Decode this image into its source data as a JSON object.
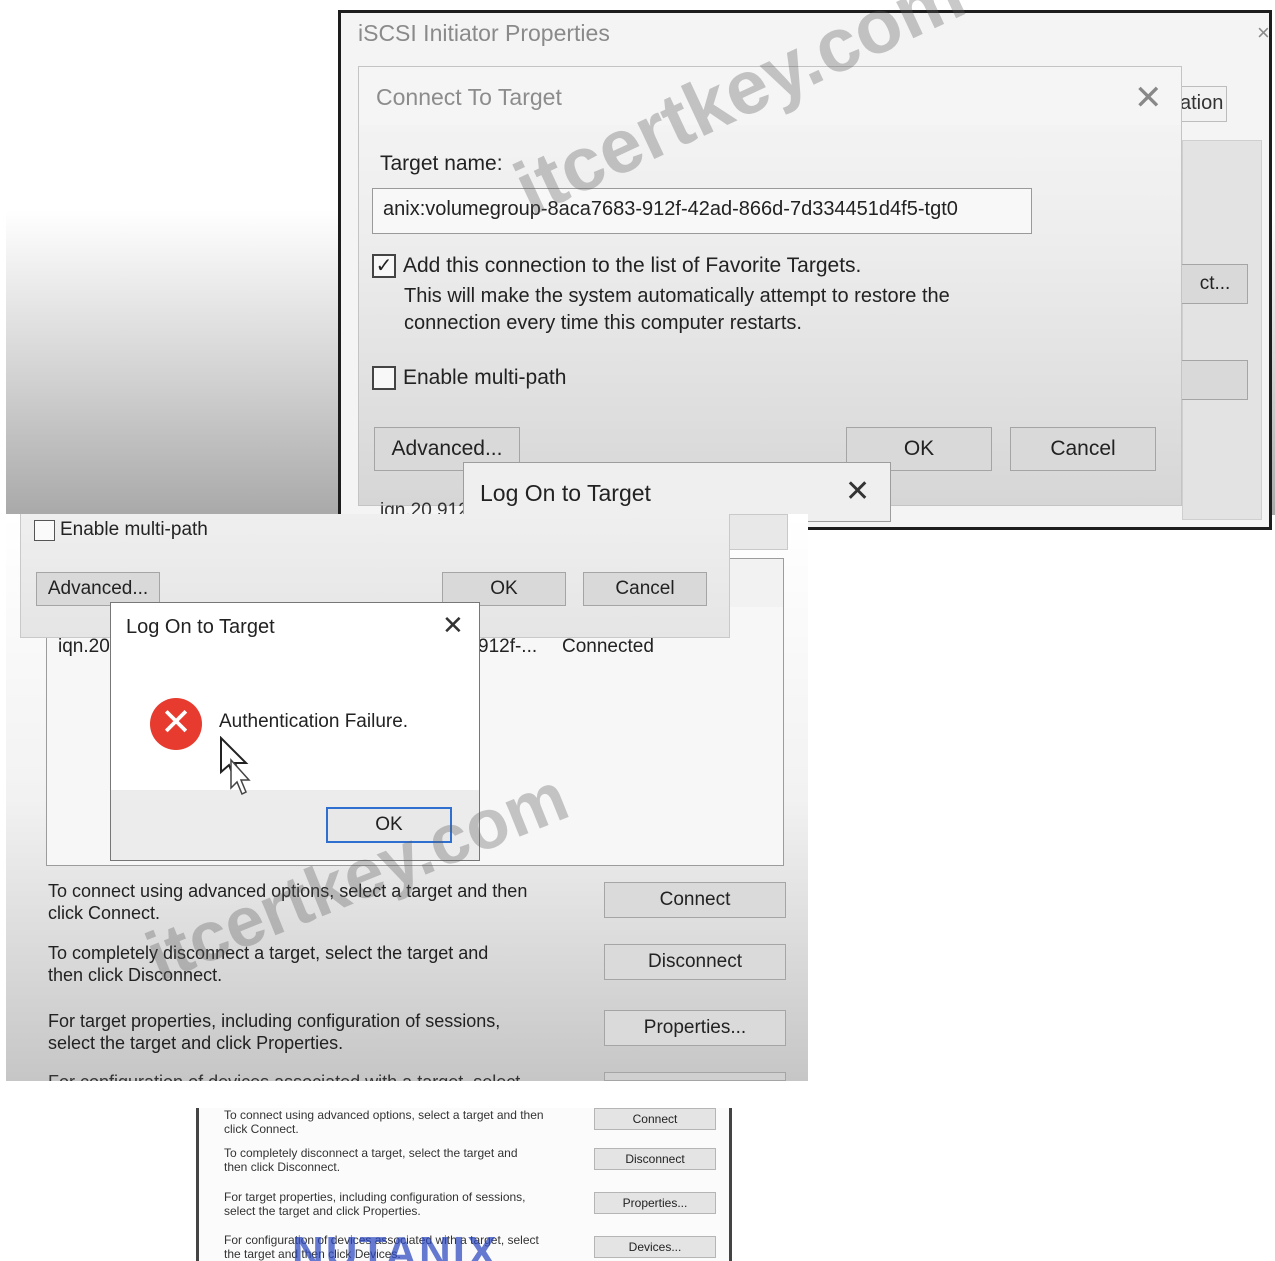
{
  "outer_window": {
    "title": "iSCSI Initiator Properties",
    "close_glyph": "×",
    "tab_fragment": "ation",
    "side_button_fragment": "ct..."
  },
  "connect_dialog": {
    "title": "Connect To Target",
    "close_glyph": "✕",
    "target_name_label": "Target name:",
    "target_name_value": "anix:volumegroup-8aca7683-912f-42ad-866d-7d334451d4f5-tgt0",
    "favorite_checkbox": {
      "checked": true,
      "glyph": "✓",
      "label": "Add this connection to the list of Favorite Targets.",
      "note_line1": "This will make the system automatically attempt to restore the",
      "note_line2": "connection every time this computer restarts."
    },
    "multipath_checkbox": {
      "checked": false,
      "label": "Enable multi-path"
    },
    "advanced_button": "Advanced...",
    "ok_button": "OK",
    "cancel_button": "Cancel"
  },
  "logon_dialog": {
    "title": "Log On to Target",
    "close_glyph": "✕",
    "error_glyph": "✕",
    "message": "Authentication Failure.",
    "ok_button": "OK"
  },
  "panel1_background": {
    "row_fragment": "iqn.20                                              912f        Connected"
  },
  "targets_list": {
    "row": {
      "iqn_fragment": "iqn.20",
      "name_fragment": "912f-...",
      "status": "Connected"
    }
  },
  "actions": [
    {
      "line1": "To connect using advanced options, select a target and then",
      "line2": "click Connect.",
      "button": "Connect"
    },
    {
      "line1": "To completely disconnect a target, select the target and",
      "line2": "then click Disconnect.",
      "button": "Disconnect"
    },
    {
      "line1": "For target properties, including configuration of sessions,",
      "line2": "select the target and click Properties.",
      "button": "Properties..."
    },
    {
      "line1": "For configuration of devices associated with a target, select",
      "line2": "the target and then click Devices.",
      "button": "Devices..."
    }
  ],
  "watermark": {
    "text1": "itcertkey.com",
    "text2": "itcertkey.com",
    "logo": "NUTANIX"
  }
}
